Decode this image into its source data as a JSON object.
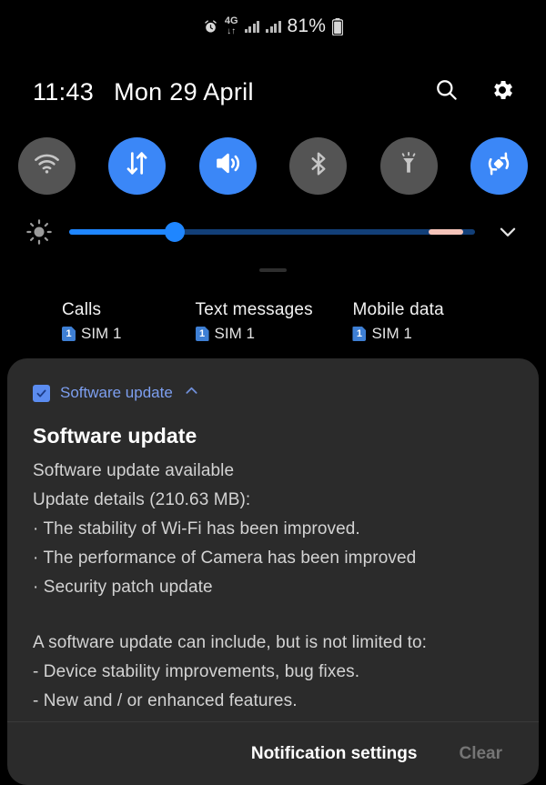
{
  "statusbar": {
    "alarm_icon": "alarm-clock-icon",
    "network_type": "4G",
    "network_arrows": "↓↑",
    "signal_icon_1": "signal-bars-icon",
    "signal_icon_2": "signal-bars-icon",
    "battery_percent": "81%",
    "battery_icon": "battery-icon"
  },
  "header": {
    "time": "11:43",
    "date": "Mon 29 April",
    "search_icon": "search-icon",
    "settings_icon": "gear-icon"
  },
  "quick_settings": {
    "toggles": [
      {
        "name": "wifi",
        "icon": "wifi-icon",
        "state": "off"
      },
      {
        "name": "mobile-data",
        "icon": "data-arrows-icon",
        "state": "on"
      },
      {
        "name": "sound",
        "icon": "volume-icon",
        "state": "on"
      },
      {
        "name": "bluetooth",
        "icon": "bluetooth-icon",
        "state": "off"
      },
      {
        "name": "flashlight",
        "icon": "flashlight-icon",
        "state": "off"
      },
      {
        "name": "auto-rotate",
        "icon": "auto-rotate-icon",
        "state": "on"
      }
    ],
    "brightness": {
      "icon": "brightness-sun-icon",
      "value_percent": 26,
      "expand_icon": "chevron-down-icon"
    },
    "drag_handle": "drag-handle"
  },
  "sim_status": [
    {
      "title": "Calls",
      "badge": "1",
      "sim": "SIM 1"
    },
    {
      "title": "Text messages",
      "badge": "1",
      "sim": "SIM 1"
    },
    {
      "title": "Mobile data",
      "badge": "1",
      "sim": "SIM 1"
    }
  ],
  "notification": {
    "app_name": "Software update",
    "collapse_icon": "chevron-up-icon",
    "checkbox_icon": "checkmark-icon",
    "title": "Software update",
    "lines": [
      "Software update available",
      "Update details (210.63 MB):",
      "· The stability of Wi-Fi has been improved.",
      "· The performance of Camera has been improved",
      "· Security patch update"
    ],
    "lines2": [
      "A software update can include, but is not limited to:",
      " - Device stability improvements, bug fixes.",
      " - New and / or enhanced features."
    ]
  },
  "action_bar": {
    "settings_label": "Notification settings",
    "clear_label": "Clear"
  },
  "colors": {
    "accent_blue": "#3b87f7",
    "toggle_off": "#545454",
    "card_bg": "#2b2b2b",
    "app_name_blue": "#7d9ff0",
    "slider_pink": "#f4c3b9"
  }
}
